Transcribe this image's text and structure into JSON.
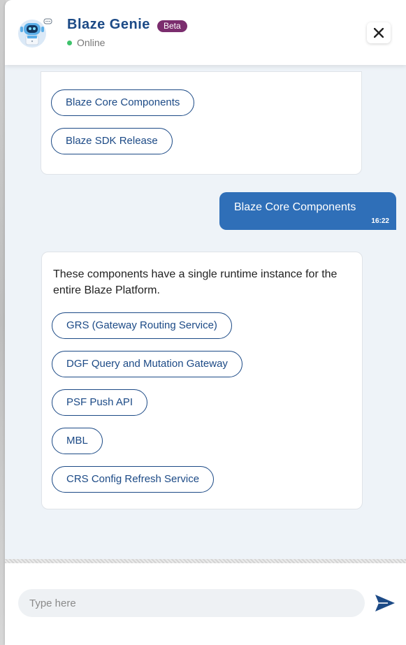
{
  "header": {
    "title": "Blaze Genie",
    "badge": "Beta",
    "status": "Online"
  },
  "messages": {
    "first_card_options": [
      "Blaze Core Components",
      "Blaze SDK Release"
    ],
    "user_message": {
      "text": "Blaze Core Components",
      "time": "16:22"
    },
    "bot_reply": {
      "text": "These components have a single runtime instance for the entire Blaze Platform.",
      "options": [
        "GRS (Gateway Routing Service)",
        "DGF Query and Mutation Gateway",
        "PSF Push API",
        "MBL",
        "CRS Config Refresh Service"
      ]
    }
  },
  "composer": {
    "placeholder": "Type here"
  },
  "colors": {
    "brand": "#1c4a86",
    "user_bubble": "#2f6fb8",
    "badge": "#7b2d6e",
    "online": "#3ec26b"
  },
  "icons": [
    "robot-avatar-icon",
    "close-icon",
    "send-icon"
  ]
}
